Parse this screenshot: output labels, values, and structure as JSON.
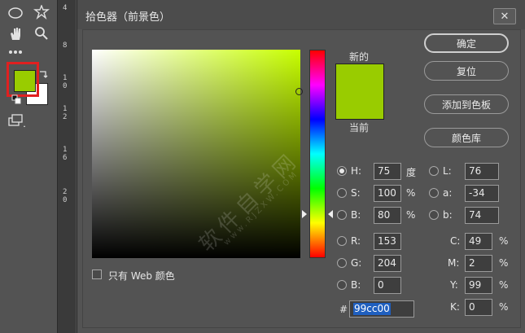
{
  "dialog": {
    "title": "拾色器（前景色）",
    "close_label": "✕",
    "new_label": "新的",
    "current_label": "当前",
    "new_color": "#99cc00",
    "current_color": "#99cc00",
    "web_only_label": "只有 Web 颜色",
    "buttons": {
      "ok": "确定",
      "reset": "复位",
      "add_swatch": "添加到色板",
      "libraries": "颜色库"
    },
    "hsb": {
      "h": {
        "label": "H:",
        "value": "75",
        "unit": "度"
      },
      "s": {
        "label": "S:",
        "value": "100",
        "unit": "%"
      },
      "b": {
        "label": "B:",
        "value": "80",
        "unit": "%"
      }
    },
    "rgb": {
      "r": {
        "label": "R:",
        "value": "153"
      },
      "g": {
        "label": "G:",
        "value": "204"
      },
      "b": {
        "label": "B:",
        "value": "0"
      }
    },
    "lab": {
      "l": {
        "label": "L:",
        "value": "76"
      },
      "a": {
        "label": "a:",
        "value": "-34"
      },
      "b": {
        "label": "b:",
        "value": "74"
      }
    },
    "cmyk": {
      "c": {
        "label": "C:",
        "value": "49",
        "unit": "%"
      },
      "m": {
        "label": "M:",
        "value": "2",
        "unit": "%"
      },
      "y": {
        "label": "Y:",
        "value": "99",
        "unit": "%"
      },
      "k": {
        "label": "K:",
        "value": "0",
        "unit": "%"
      }
    },
    "hex": {
      "label": "#",
      "value": "99cc00"
    }
  },
  "ruler": {
    "ticks": [
      "4",
      "8",
      "1",
      "0",
      "1",
      "2",
      "1",
      "6",
      "2",
      "0"
    ]
  },
  "watermark": {
    "text": "软件自学网",
    "url": "www.RJZXW.COM"
  },
  "colors": {
    "foreground": "#99cc00",
    "background": "#ffffff",
    "highlight": "#e02020"
  }
}
